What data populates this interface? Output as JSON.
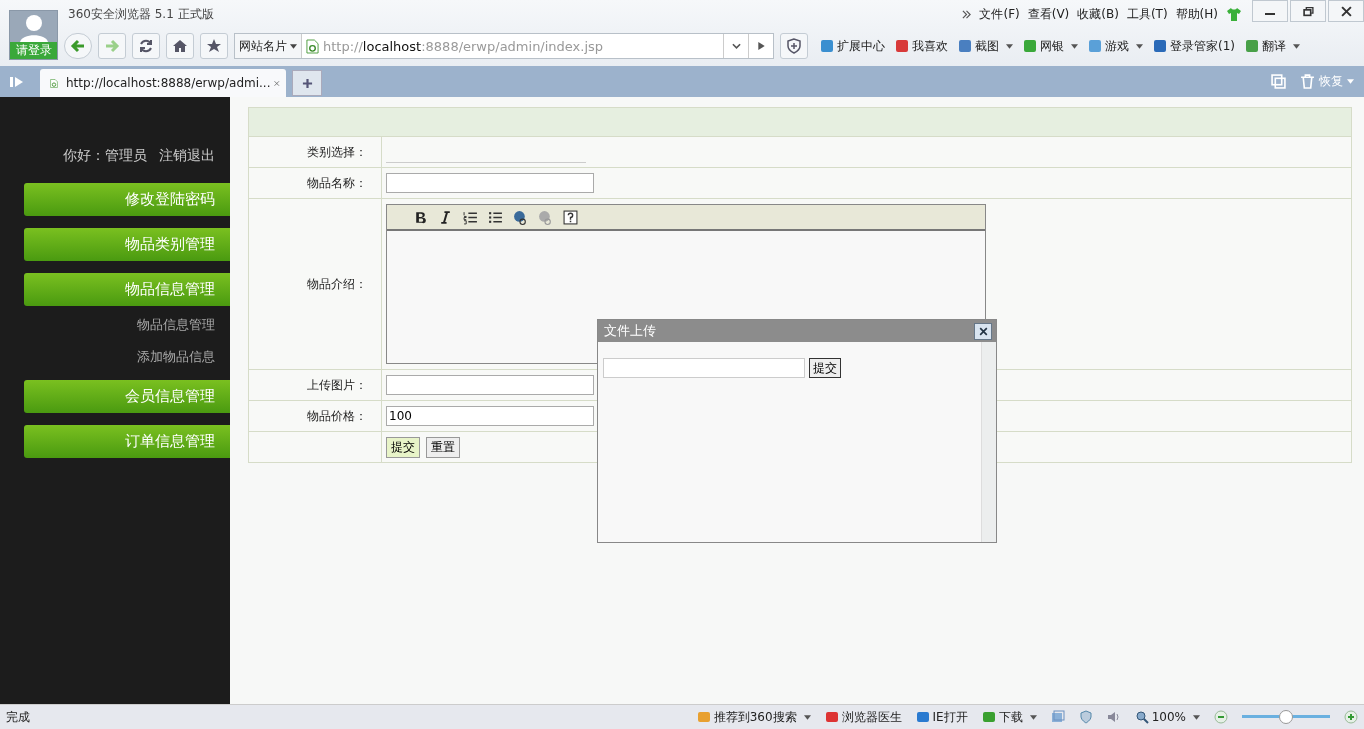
{
  "browser": {
    "title": "360安全浏览器 5.1 正式版",
    "login_label": "请登录",
    "menu": [
      "文件(F)",
      "查看(V)",
      "收藏(B)",
      "工具(T)",
      "帮助(H)"
    ],
    "address": {
      "site_card": "网站名片",
      "url_prefix": "http://",
      "url_host": "localhost",
      "url_rest": ":8888/erwp/admin/index.jsp"
    },
    "toolbar": [
      {
        "label": "扩展中心",
        "dropdown": false,
        "color": "#3a8fd0"
      },
      {
        "label": "我喜欢",
        "dropdown": false,
        "color": "#d83a3a"
      },
      {
        "label": "截图",
        "dropdown": true,
        "color": "#4a7fc0"
      },
      {
        "label": "网银",
        "dropdown": true,
        "color": "#3aa83a"
      },
      {
        "label": "游戏",
        "dropdown": true,
        "color": "#5aa0d8"
      },
      {
        "label": "登录管家(1)",
        "dropdown": false,
        "color": "#2a6ab8"
      },
      {
        "label": "翻译",
        "dropdown": true,
        "color": "#48a048"
      }
    ],
    "tabs": [
      {
        "label": "http://localhost:8888/erwp/admi...",
        "selected": true
      }
    ],
    "restore_label": "恢复"
  },
  "sidebar": {
    "greeting": "你好：管理员",
    "logout": "注销退出",
    "menu": [
      {
        "label": "修改登陆密码"
      },
      {
        "label": "物品类别管理"
      },
      {
        "label": "物品信息管理",
        "expanded": true,
        "children": [
          {
            "label": "物品信息管理"
          },
          {
            "label": "添加物品信息"
          }
        ]
      },
      {
        "label": "会员信息管理"
      },
      {
        "label": "订单信息管理"
      }
    ]
  },
  "form": {
    "rows": [
      {
        "label": "类别选择：",
        "kind": "select"
      },
      {
        "label": "物品名称：",
        "kind": "text"
      },
      {
        "label": "物品介绍：",
        "kind": "editor"
      },
      {
        "label": "上传图片：",
        "kind": "text"
      },
      {
        "label": "物品价格：",
        "kind": "text",
        "value": "100"
      }
    ],
    "buttons": [
      {
        "label": "提交",
        "highlighted": true
      },
      {
        "label": "重置",
        "highlighted": false
      }
    ]
  },
  "upload_dialog": {
    "title": "文件上传",
    "button": "提交"
  },
  "status_bar": {
    "status": "完成",
    "items": [
      {
        "label": "推荐到360搜索",
        "dropdown": true
      },
      {
        "label": "浏览器医生",
        "dropdown": false
      },
      {
        "label": "IE打开",
        "dropdown": false
      },
      {
        "label": "下载",
        "dropdown": true
      }
    ],
    "zoom": "100%",
    "zoom_slider": {
      "level": 0.5
    }
  }
}
